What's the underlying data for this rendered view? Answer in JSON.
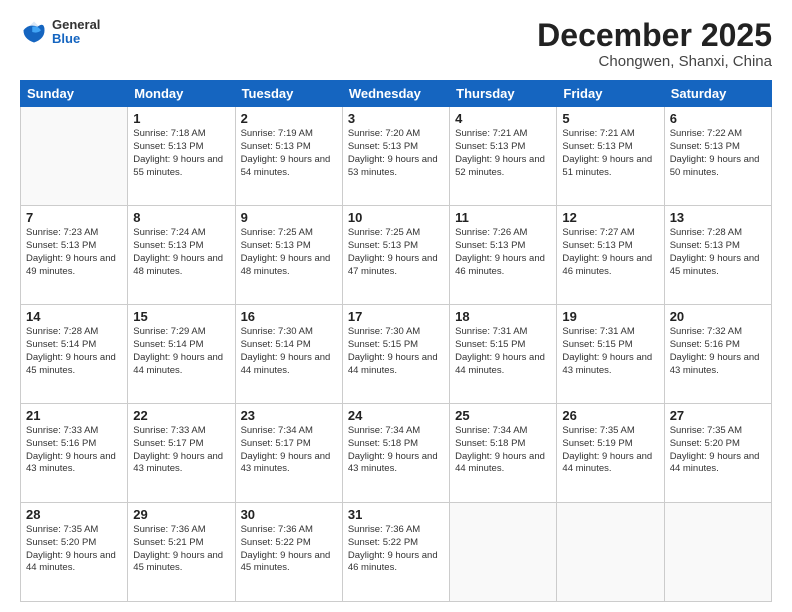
{
  "header": {
    "logo": {
      "general": "General",
      "blue": "Blue"
    },
    "title": "December 2025",
    "location": "Chongwen, Shanxi, China"
  },
  "weekdays": [
    "Sunday",
    "Monday",
    "Tuesday",
    "Wednesday",
    "Thursday",
    "Friday",
    "Saturday"
  ],
  "weeks": [
    [
      {
        "day": "",
        "sunrise": "",
        "sunset": "",
        "daylight": ""
      },
      {
        "day": "1",
        "sunrise": "Sunrise: 7:18 AM",
        "sunset": "Sunset: 5:13 PM",
        "daylight": "Daylight: 9 hours and 55 minutes."
      },
      {
        "day": "2",
        "sunrise": "Sunrise: 7:19 AM",
        "sunset": "Sunset: 5:13 PM",
        "daylight": "Daylight: 9 hours and 54 minutes."
      },
      {
        "day": "3",
        "sunrise": "Sunrise: 7:20 AM",
        "sunset": "Sunset: 5:13 PM",
        "daylight": "Daylight: 9 hours and 53 minutes."
      },
      {
        "day": "4",
        "sunrise": "Sunrise: 7:21 AM",
        "sunset": "Sunset: 5:13 PM",
        "daylight": "Daylight: 9 hours and 52 minutes."
      },
      {
        "day": "5",
        "sunrise": "Sunrise: 7:21 AM",
        "sunset": "Sunset: 5:13 PM",
        "daylight": "Daylight: 9 hours and 51 minutes."
      },
      {
        "day": "6",
        "sunrise": "Sunrise: 7:22 AM",
        "sunset": "Sunset: 5:13 PM",
        "daylight": "Daylight: 9 hours and 50 minutes."
      }
    ],
    [
      {
        "day": "7",
        "sunrise": "Sunrise: 7:23 AM",
        "sunset": "Sunset: 5:13 PM",
        "daylight": "Daylight: 9 hours and 49 minutes."
      },
      {
        "day": "8",
        "sunrise": "Sunrise: 7:24 AM",
        "sunset": "Sunset: 5:13 PM",
        "daylight": "Daylight: 9 hours and 48 minutes."
      },
      {
        "day": "9",
        "sunrise": "Sunrise: 7:25 AM",
        "sunset": "Sunset: 5:13 PM",
        "daylight": "Daylight: 9 hours and 48 minutes."
      },
      {
        "day": "10",
        "sunrise": "Sunrise: 7:25 AM",
        "sunset": "Sunset: 5:13 PM",
        "daylight": "Daylight: 9 hours and 47 minutes."
      },
      {
        "day": "11",
        "sunrise": "Sunrise: 7:26 AM",
        "sunset": "Sunset: 5:13 PM",
        "daylight": "Daylight: 9 hours and 46 minutes."
      },
      {
        "day": "12",
        "sunrise": "Sunrise: 7:27 AM",
        "sunset": "Sunset: 5:13 PM",
        "daylight": "Daylight: 9 hours and 46 minutes."
      },
      {
        "day": "13",
        "sunrise": "Sunrise: 7:28 AM",
        "sunset": "Sunset: 5:13 PM",
        "daylight": "Daylight: 9 hours and 45 minutes."
      }
    ],
    [
      {
        "day": "14",
        "sunrise": "Sunrise: 7:28 AM",
        "sunset": "Sunset: 5:14 PM",
        "daylight": "Daylight: 9 hours and 45 minutes."
      },
      {
        "day": "15",
        "sunrise": "Sunrise: 7:29 AM",
        "sunset": "Sunset: 5:14 PM",
        "daylight": "Daylight: 9 hours and 44 minutes."
      },
      {
        "day": "16",
        "sunrise": "Sunrise: 7:30 AM",
        "sunset": "Sunset: 5:14 PM",
        "daylight": "Daylight: 9 hours and 44 minutes."
      },
      {
        "day": "17",
        "sunrise": "Sunrise: 7:30 AM",
        "sunset": "Sunset: 5:15 PM",
        "daylight": "Daylight: 9 hours and 44 minutes."
      },
      {
        "day": "18",
        "sunrise": "Sunrise: 7:31 AM",
        "sunset": "Sunset: 5:15 PM",
        "daylight": "Daylight: 9 hours and 44 minutes."
      },
      {
        "day": "19",
        "sunrise": "Sunrise: 7:31 AM",
        "sunset": "Sunset: 5:15 PM",
        "daylight": "Daylight: 9 hours and 43 minutes."
      },
      {
        "day": "20",
        "sunrise": "Sunrise: 7:32 AM",
        "sunset": "Sunset: 5:16 PM",
        "daylight": "Daylight: 9 hours and 43 minutes."
      }
    ],
    [
      {
        "day": "21",
        "sunrise": "Sunrise: 7:33 AM",
        "sunset": "Sunset: 5:16 PM",
        "daylight": "Daylight: 9 hours and 43 minutes."
      },
      {
        "day": "22",
        "sunrise": "Sunrise: 7:33 AM",
        "sunset": "Sunset: 5:17 PM",
        "daylight": "Daylight: 9 hours and 43 minutes."
      },
      {
        "day": "23",
        "sunrise": "Sunrise: 7:34 AM",
        "sunset": "Sunset: 5:17 PM",
        "daylight": "Daylight: 9 hours and 43 minutes."
      },
      {
        "day": "24",
        "sunrise": "Sunrise: 7:34 AM",
        "sunset": "Sunset: 5:18 PM",
        "daylight": "Daylight: 9 hours and 43 minutes."
      },
      {
        "day": "25",
        "sunrise": "Sunrise: 7:34 AM",
        "sunset": "Sunset: 5:18 PM",
        "daylight": "Daylight: 9 hours and 44 minutes."
      },
      {
        "day": "26",
        "sunrise": "Sunrise: 7:35 AM",
        "sunset": "Sunset: 5:19 PM",
        "daylight": "Daylight: 9 hours and 44 minutes."
      },
      {
        "day": "27",
        "sunrise": "Sunrise: 7:35 AM",
        "sunset": "Sunset: 5:20 PM",
        "daylight": "Daylight: 9 hours and 44 minutes."
      }
    ],
    [
      {
        "day": "28",
        "sunrise": "Sunrise: 7:35 AM",
        "sunset": "Sunset: 5:20 PM",
        "daylight": "Daylight: 9 hours and 44 minutes."
      },
      {
        "day": "29",
        "sunrise": "Sunrise: 7:36 AM",
        "sunset": "Sunset: 5:21 PM",
        "daylight": "Daylight: 9 hours and 45 minutes."
      },
      {
        "day": "30",
        "sunrise": "Sunrise: 7:36 AM",
        "sunset": "Sunset: 5:22 PM",
        "daylight": "Daylight: 9 hours and 45 minutes."
      },
      {
        "day": "31",
        "sunrise": "Sunrise: 7:36 AM",
        "sunset": "Sunset: 5:22 PM",
        "daylight": "Daylight: 9 hours and 46 minutes."
      },
      {
        "day": "",
        "sunrise": "",
        "sunset": "",
        "daylight": ""
      },
      {
        "day": "",
        "sunrise": "",
        "sunset": "",
        "daylight": ""
      },
      {
        "day": "",
        "sunrise": "",
        "sunset": "",
        "daylight": ""
      }
    ]
  ]
}
